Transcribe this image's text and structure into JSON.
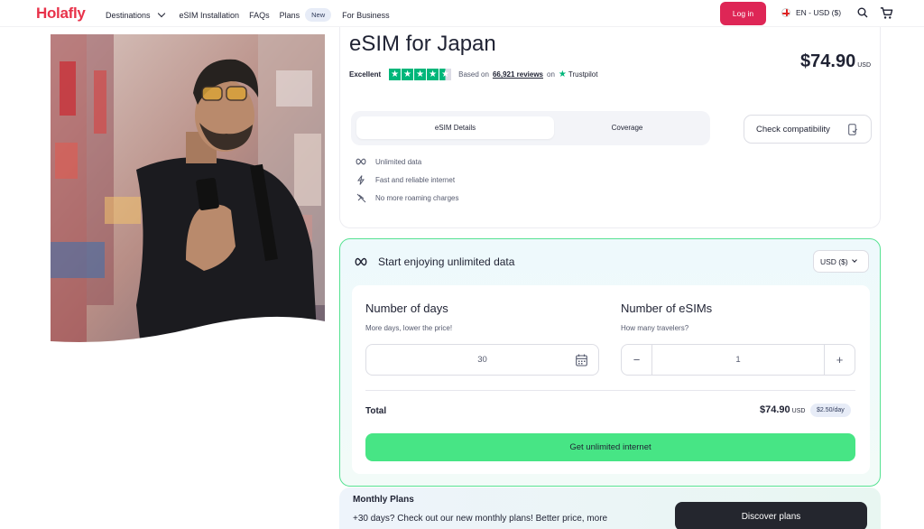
{
  "header": {
    "logo": "Holafly",
    "nav": [
      {
        "label": "Destinations"
      },
      {
        "label": "eSIM Installation"
      },
      {
        "label": "FAQs"
      },
      {
        "label": "Plans"
      },
      {
        "label": "For Business"
      }
    ],
    "new_badge": "New",
    "login_label": "Log in",
    "language": "EN - USD ($)",
    "brand_color": "#de2656"
  },
  "product": {
    "title": "eSIM for Japan",
    "rating_word": "Excellent",
    "stars": 4.5,
    "based_on": "Based on",
    "reviews": "66,921 reviews",
    "on_word": "on",
    "trustpilot": "Trustpilot",
    "price": "$74.90",
    "price_currency": "USD",
    "tabs": [
      {
        "label": "eSIM Details",
        "active": true
      },
      {
        "label": "Coverage",
        "active": false
      }
    ],
    "compat_label": "Check compatibility",
    "features": [
      {
        "icon": "infinity-icon",
        "label": "Unlimited data"
      },
      {
        "icon": "bolt-icon",
        "label": "Fast and reliable internet"
      },
      {
        "icon": "no-roaming-icon",
        "label": "No more roaming charges"
      }
    ]
  },
  "plan": {
    "heading": "Start enjoying unlimited data",
    "currency_select": "USD ($)",
    "days_title": "Number of days",
    "days_sub": "More days, lower the price!",
    "days_value": "30",
    "esims_title": "Number of eSIMs",
    "esims_sub": "How many travelers?",
    "esims_value": "1",
    "minus": "−",
    "plus": "+",
    "total_label": "Total",
    "total_price": "$74.90",
    "total_currency": "USD",
    "per_day": "$2.50/day",
    "cta": "Get unlimited internet",
    "accent_color": "#47e585"
  },
  "monthly": {
    "title": "Monthly Plans",
    "desc": "+30 days? Check out our new monthly plans! Better price, more",
    "button": "Discover plans"
  }
}
